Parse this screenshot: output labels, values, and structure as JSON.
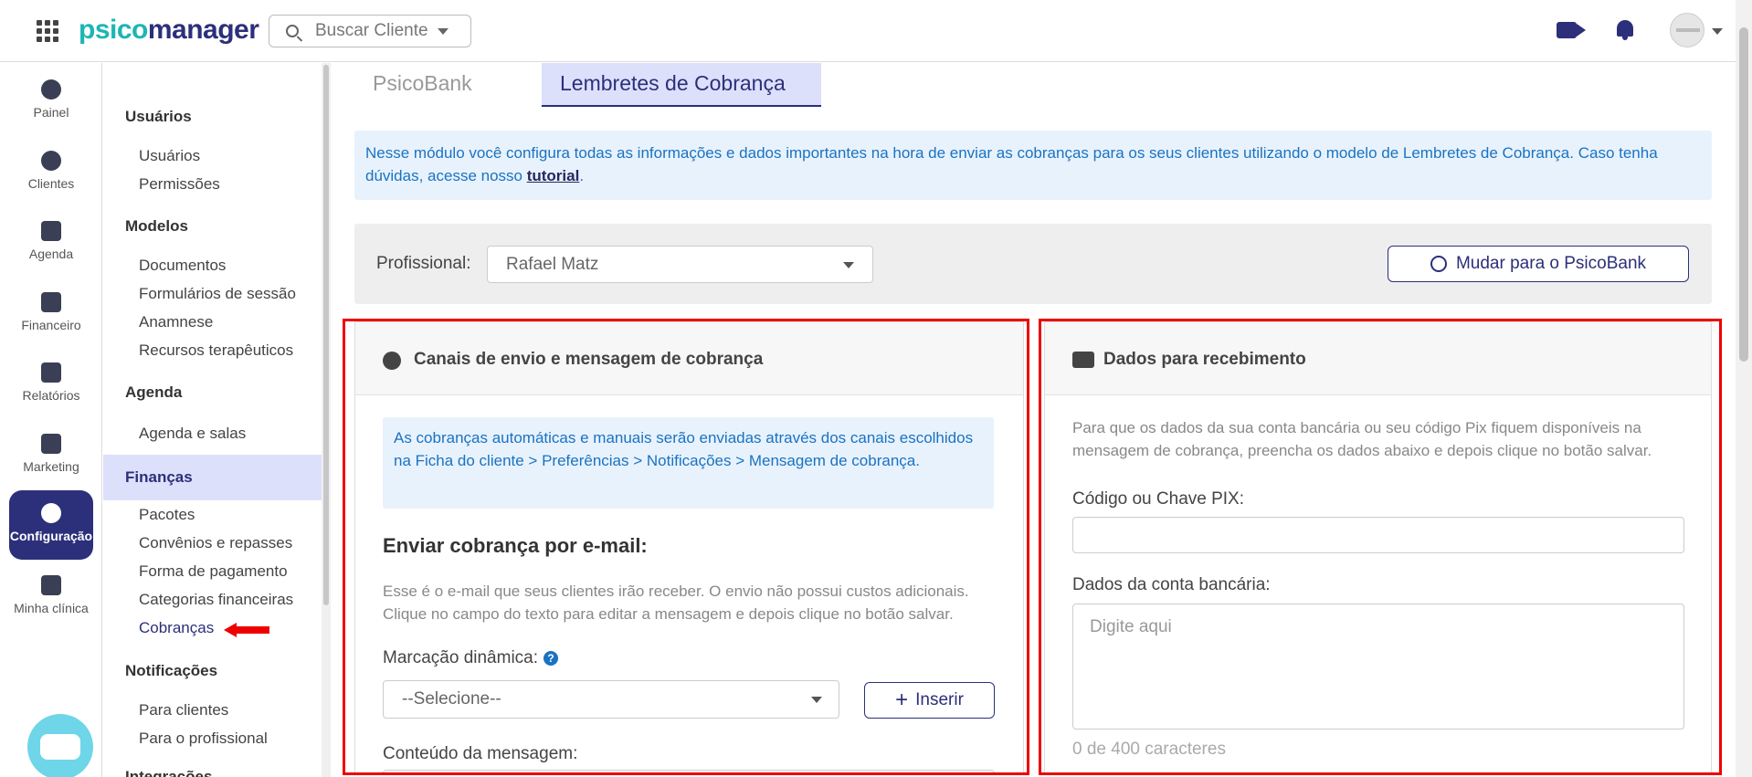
{
  "header": {
    "logo_psico": "psico",
    "logo_manager": "manager",
    "search_placeholder": "Buscar Cliente"
  },
  "iconbar": [
    {
      "label": "Painel",
      "icon": "dashboard-icon"
    },
    {
      "label": "Clientes",
      "icon": "users-icon"
    },
    {
      "label": "Agenda",
      "icon": "calendar-icon"
    },
    {
      "label": "Financeiro",
      "icon": "money-icon"
    },
    {
      "label": "Relatórios",
      "icon": "document-icon"
    },
    {
      "label": "Marketing",
      "icon": "megaphone-icon"
    },
    {
      "label": "Configuração",
      "icon": "gear-icon",
      "active": true
    },
    {
      "label": "Minha clínica",
      "icon": "building-icon"
    }
  ],
  "menu": {
    "usuarios_h": "Usuários",
    "usuarios": "Usuários",
    "permissoes": "Permissões",
    "modelos_h": "Modelos",
    "documentos": "Documentos",
    "formularios": "Formulários de sessão",
    "anamnese": "Anamnese",
    "recursos": "Recursos terapêuticos",
    "agenda_h": "Agenda",
    "agenda_salas": "Agenda e salas",
    "financas_h": "Finanças",
    "pacotes": "Pacotes",
    "convenios": "Convênios e repasses",
    "forma_pagamento": "Forma de pagamento",
    "categorias": "Categorias financeiras",
    "cobrancas": "Cobranças",
    "notificacoes_h": "Notificações",
    "para_clientes": "Para clientes",
    "para_profissional": "Para o profissional",
    "integracoes_h": "Integrações"
  },
  "tabs": {
    "psicobank": "PsicoBank",
    "lembretes": "Lembretes de Cobrança"
  },
  "info": {
    "text": "Nesse módulo você configura todas as informações e dados importantes na hora de enviar as cobranças para os seus clientes utilizando o modelo de Lembretes de Cobrança. Caso tenha dúvidas, acesse nosso ",
    "link": "tutorial",
    "end": "."
  },
  "professional": {
    "label": "Profissional:",
    "value": "Rafael Matz",
    "switch_button": "Mudar para o PsicoBank"
  },
  "left_panel": {
    "title": "Canais de envio e mensagem de cobrança",
    "note": "As cobranças automáticas e manuais serão enviadas através dos canais escolhidos na Ficha do cliente > Preferências > Notificações > Mensagem de cobrança.",
    "email_title": "Enviar cobrança por e-mail:",
    "email_desc": "Esse é o e-mail que seus clientes irão receber. O envio não possui custos adicionais. Clique no campo do texto para editar a mensagem e depois clique no botão salvar.",
    "dynamic_label": "Marcação dinâmica:",
    "dynamic_help": "?",
    "dynamic_select": "--Selecione--",
    "insert_button": "Inserir",
    "content_label": "Conteúdo da mensagem:"
  },
  "right_panel": {
    "title": "Dados para recebimento",
    "desc": "Para que os dados da sua conta bancária ou seu código Pix fiquem disponíveis na mensagem de cobrança, preencha os dados abaixo e depois clique no botão salvar.",
    "pix_label": "Código ou Chave PIX:",
    "pix_value": "",
    "bank_label": "Dados da conta bancária:",
    "bank_placeholder": "Digite aqui",
    "counter": "0 de 400 caracteres"
  },
  "colors": {
    "brand_dark": "#2c2f7a",
    "brand_teal": "#1db5b5",
    "info_blue": "#1a73c1",
    "highlight_red": "#e00000"
  }
}
